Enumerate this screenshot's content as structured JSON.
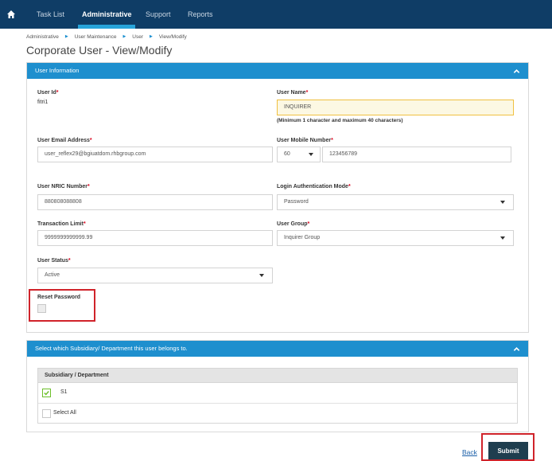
{
  "nav": {
    "items": [
      {
        "label": "Task List"
      },
      {
        "label": "Administrative"
      },
      {
        "label": "Support"
      },
      {
        "label": "Reports"
      }
    ]
  },
  "breadcrumb": [
    "Administrative",
    "User Maintenance",
    "User",
    "View/Modify"
  ],
  "page_title": "Corporate User - View/Modify",
  "user_info": {
    "header": "User Information",
    "user_id": {
      "label": "User Id",
      "value": "fitri1"
    },
    "user_name": {
      "label": "User Name",
      "value": "INQUIRER",
      "hint": "(Minimum 1 character and maximum 40 characters)"
    },
    "email": {
      "label": "User Email Address",
      "value": "user_reflex29@bgiuatdom.rhbgroup.com"
    },
    "mobile": {
      "label": "User Mobile Number",
      "code": "60",
      "number": "123456789"
    },
    "nric": {
      "label": "User NRIC Number",
      "value": "880808088808"
    },
    "auth_mode": {
      "label": "Login Authentication Mode",
      "value": "Password"
    },
    "txn_limit": {
      "label": "Transaction Limit",
      "value": "9999999999999.99"
    },
    "user_group": {
      "label": "User Group",
      "value": "Inquirer Group"
    },
    "status": {
      "label": "User Status",
      "value": "Active"
    },
    "reset_password": {
      "label": "Reset Password",
      "checked": false
    },
    "required_mark": "*"
  },
  "subsidiary": {
    "header": "Select which Subsidiary/ Department this user belongs to.",
    "column": "Subsidiary / Department",
    "rows": [
      {
        "label": "S1",
        "checked": true
      }
    ],
    "select_all": "Select All"
  },
  "actions": {
    "back": "Back",
    "submit": "Submit"
  },
  "colors": {
    "nav_bg": "#0f3d66",
    "panel_header": "#1e8fce",
    "submit_bg": "#1f3e4f",
    "highlight": "#d0232a"
  }
}
